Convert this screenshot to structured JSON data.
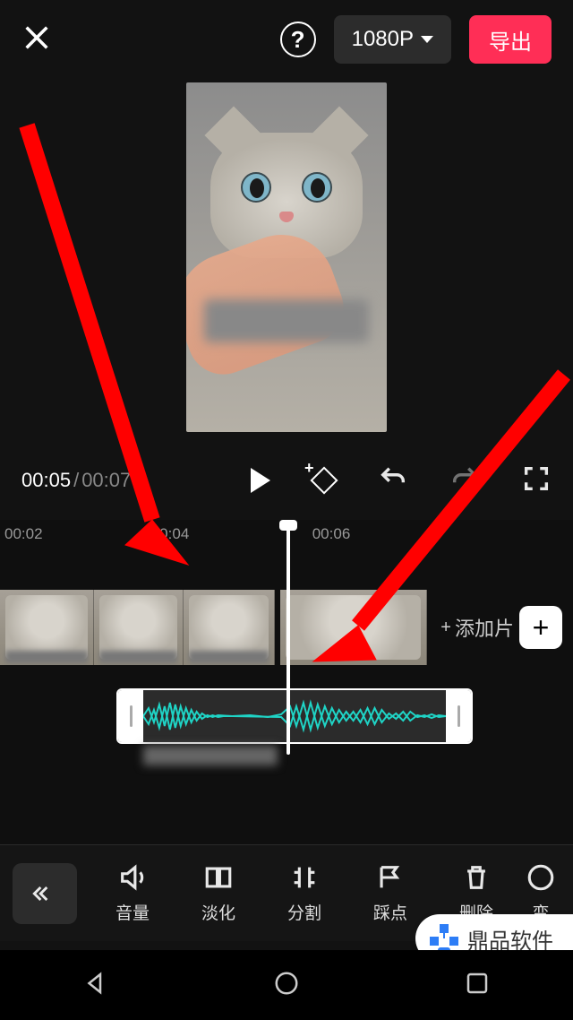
{
  "header": {
    "resolution_label": "1080P",
    "export_label": "导出"
  },
  "playback": {
    "current_time": "00:05",
    "total_time": "00:07"
  },
  "timeline": {
    "ticks": [
      "00:02",
      "00:04",
      "00:06"
    ],
    "add_clip_label": "添加片"
  },
  "toolbar": {
    "items": [
      {
        "label": "音量"
      },
      {
        "label": "淡化"
      },
      {
        "label": "分割"
      },
      {
        "label": "踩点"
      },
      {
        "label": "删除"
      },
      {
        "label": "变"
      }
    ]
  },
  "watermark": {
    "text": "鼎品软件"
  }
}
